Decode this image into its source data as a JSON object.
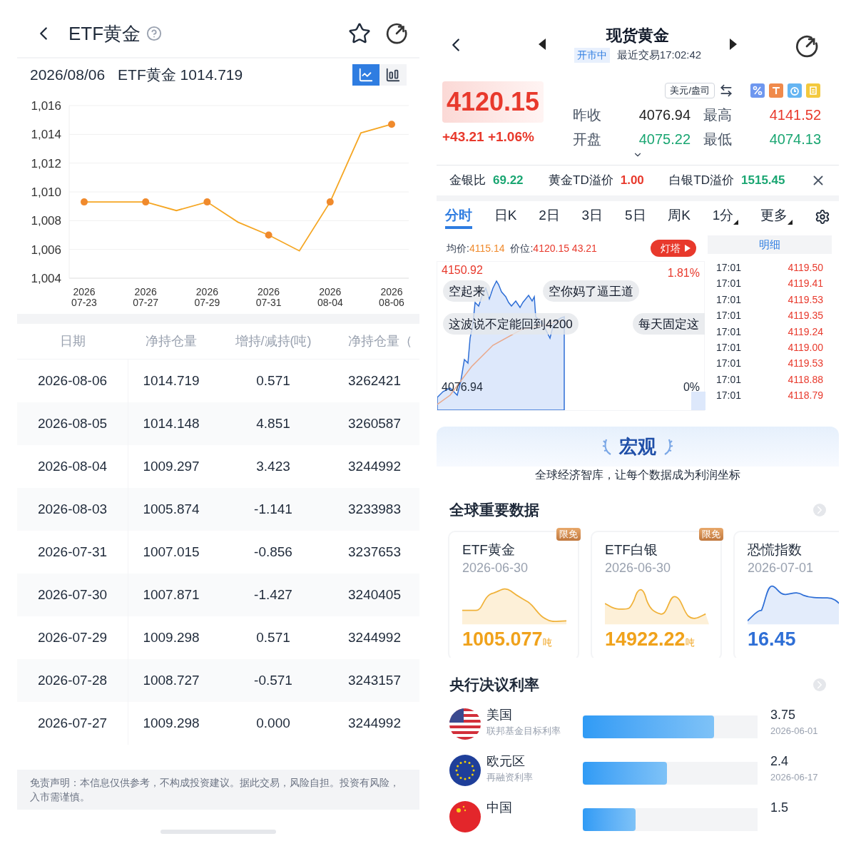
{
  "left": {
    "header": {
      "title": "ETF黄金"
    },
    "summary": {
      "date": "2026/08/06",
      "label": "ETF黄金 1014.719"
    },
    "chart_toggle": [
      {
        "kind": "line",
        "selected": true
      },
      {
        "kind": "bar",
        "selected": false
      }
    ],
    "chart_data": {
      "type": "line",
      "grid": true,
      "categories": [
        "2026\n07-23",
        null,
        "2026\n07-27",
        null,
        "2026\n07-29",
        null,
        "2026\n07-31",
        null,
        "2026\n08-04",
        null,
        "2026\n08-06"
      ],
      "series": [
        {
          "color": "#f5a623",
          "values": [
            1009.3,
            1009.3,
            1009.3,
            1008.7,
            1009.3,
            1007.9,
            1007.0,
            1005.9,
            1009.3,
            1014.1,
            1014.7
          ]
        }
      ],
      "ylim": [
        1004,
        1016
      ],
      "yticks": [
        {
          "value": 1004,
          "label": "1,004"
        },
        {
          "value": 1006,
          "label": "1,006"
        },
        {
          "value": 1008,
          "label": "1,008"
        },
        {
          "value": 1010,
          "label": "1,010"
        },
        {
          "value": 1012,
          "label": "1,012"
        },
        {
          "value": 1014,
          "label": "1,014"
        },
        {
          "value": 1016,
          "label": "1,016"
        }
      ]
    },
    "table": {
      "columns": [
        "日期",
        "净持仓量",
        "增持/减持(吨)",
        "净持仓量（"
      ],
      "rows": [
        [
          "2026-08-06",
          "1014.719",
          "0.571",
          "3262421"
        ],
        [
          "2026-08-05",
          "1014.148",
          "4.851",
          "3260587"
        ],
        [
          "2026-08-04",
          "1009.297",
          "3.423",
          "3244992"
        ],
        [
          "2026-08-03",
          "1005.874",
          "-1.141",
          "3233983"
        ],
        [
          "2026-07-31",
          "1007.015",
          "-0.856",
          "3237653"
        ],
        [
          "2026-07-30",
          "1007.871",
          "-1.427",
          "3240405"
        ],
        [
          "2026-07-29",
          "1009.298",
          "0.571",
          "3244992"
        ],
        [
          "2026-07-28",
          "1008.727",
          "-0.571",
          "3243157"
        ],
        [
          "2026-07-27",
          "1009.298",
          "0.000",
          "3244992"
        ]
      ]
    },
    "disclaimer": "免责声明：本信息仅供参考，不构成投资建议。据此交易，风险自担。投资有风险，入市需谨慎。"
  },
  "right": {
    "header": {
      "title": "现货黄金",
      "status": "开市中",
      "last_trade": "最近交易17:02:42"
    },
    "quote": {
      "price": "4120.15",
      "change": "+43.21 +1.06%",
      "unit": "美元/盎司",
      "stats": [
        {
          "label": "昨收",
          "value": "4076.94",
          "color": "#222222"
        },
        {
          "label": "最高",
          "value": "4141.52",
          "color": "#e8392c"
        },
        {
          "label": "开盘",
          "value": "4075.22",
          "color": "#1aa672"
        },
        {
          "label": "最低",
          "value": "4074.13",
          "color": "#1aa672"
        }
      ]
    },
    "spreads": [
      {
        "label": "金银比",
        "value": "69.22",
        "color": "#1aa672"
      },
      {
        "label": "黄金TD溢价",
        "value": "1.00",
        "color": "#e8392c"
      },
      {
        "label": "白银TD溢价",
        "value": "1515.45",
        "color": "#1aa672"
      }
    ],
    "tabs": [
      {
        "label": "分时",
        "selected": true,
        "dropdown": false
      },
      {
        "label": "日K",
        "selected": false,
        "dropdown": false
      },
      {
        "label": "2日",
        "selected": false,
        "dropdown": false
      },
      {
        "label": "3日",
        "selected": false,
        "dropdown": false
      },
      {
        "label": "5日",
        "selected": false,
        "dropdown": false
      },
      {
        "label": "周K",
        "selected": false,
        "dropdown": false
      },
      {
        "label": "1分",
        "selected": false,
        "dropdown": true
      },
      {
        "label": "更多",
        "selected": false,
        "dropdown": true
      }
    ],
    "intraday": {
      "avg_label": "均价:",
      "avg": "4115.14",
      "price_label": "价位:",
      "price": "4120.15 43.21",
      "promo": "灯塔",
      "high": "4150.92",
      "high_pct": "1.81%",
      "base": "4076.94",
      "base_pct": "0%",
      "comments": [
        "空起来",
        "空你妈了逼王道",
        "这波说不定能回到4200",
        "每天固定这"
      ]
    },
    "ticks": {
      "title": "明细",
      "rows": [
        {
          "time": "17:01",
          "price": "4119.50"
        },
        {
          "time": "17:01",
          "price": "4119.41"
        },
        {
          "time": "17:01",
          "price": "4119.53"
        },
        {
          "time": "17:01",
          "price": "4119.35"
        },
        {
          "time": "17:01",
          "price": "4119.24"
        },
        {
          "time": "17:01",
          "price": "4119.00"
        },
        {
          "time": "17:01",
          "price": "4119.53"
        },
        {
          "time": "17:01",
          "price": "4118.88"
        },
        {
          "time": "17:01",
          "price": "4118.79"
        }
      ]
    },
    "banner": {
      "title": "宏观",
      "subtitle": "全球经济智库，让每个数据成为利润坐标"
    },
    "global_data": {
      "title": "全球重要数据",
      "cards": [
        {
          "title": "ETF黄金",
          "date": "2026-06-30",
          "value": "1005.077",
          "unit": "吨",
          "badge": "限免",
          "color": "#f0a21b"
        },
        {
          "title": "ETF白银",
          "date": "2026-06-30",
          "value": "14922.22",
          "unit": "吨",
          "badge": "限免",
          "color": "#f0a21b"
        },
        {
          "title": "恐慌指数",
          "date": "2026-07-01",
          "value": "16.45",
          "color": "#2f6fd6"
        }
      ]
    },
    "rates": {
      "title": "央行决议利率",
      "rows": [
        {
          "kind": "us",
          "country": "美国",
          "name": "联邦基金目标利率",
          "value": "3.75",
          "date": "2026-06-01",
          "level": 0.75
        },
        {
          "kind": "eu",
          "country": "欧元区",
          "name": "再融资利率",
          "value": "2.4",
          "date": "2026-06-17",
          "level": 0.48
        },
        {
          "kind": "cn",
          "country": "中国",
          "value": "1.5",
          "level": 0.3
        }
      ]
    }
  }
}
